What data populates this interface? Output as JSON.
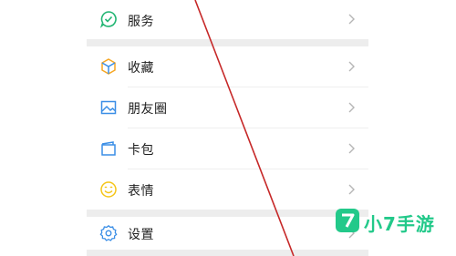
{
  "menu": {
    "items": [
      {
        "label": "服务",
        "icon": "service-icon",
        "color": "#22b573"
      },
      {
        "label": "收藏",
        "icon": "favorites-cube-icon",
        "color": "#f5a623"
      },
      {
        "label": "朋友圈",
        "icon": "moments-image-icon",
        "color": "#3a8ee6"
      },
      {
        "label": "卡包",
        "icon": "card-wallet-icon",
        "color": "#3a8ee6"
      },
      {
        "label": "表情",
        "icon": "emoji-smile-icon",
        "color": "#f5c518"
      },
      {
        "label": "设置",
        "icon": "settings-gear-icon",
        "color": "#3a8ee6"
      }
    ]
  },
  "watermark": {
    "text": "小7手游",
    "badge": "7",
    "color": "#23c98a"
  },
  "colors": {
    "separator": "#ededed",
    "chevron": "#b5b5b5",
    "annotation_line": "#c62828"
  }
}
